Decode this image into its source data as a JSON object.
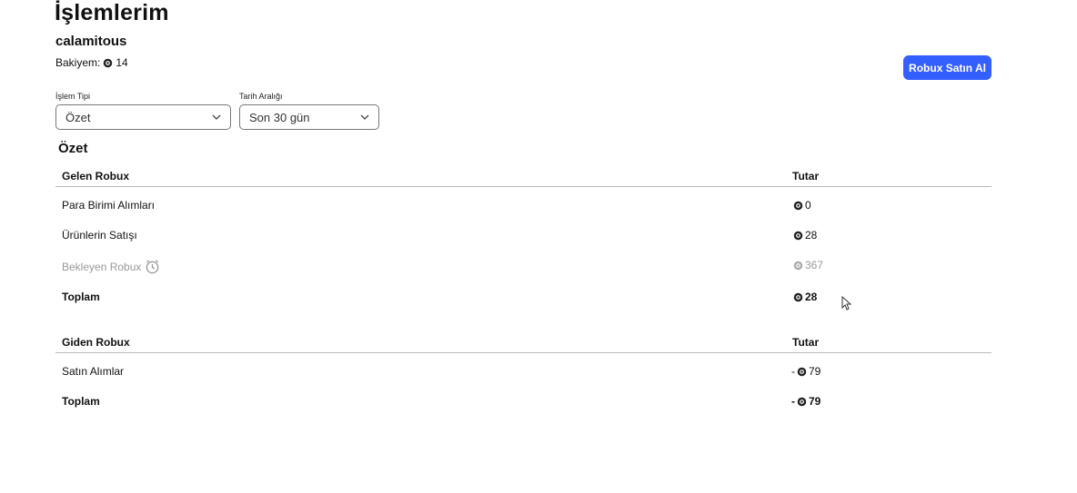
{
  "header": {
    "title": "İşlemlerim",
    "username": "calamitous",
    "balance_label": "Bakiyem:",
    "balance_value": "14",
    "buy_button": "Robux Satın Al"
  },
  "filters": {
    "type_label": "İşlem Tipi",
    "type_value": "Özet",
    "date_label": "Tarih Aralığı",
    "date_value": "Son 30 gün"
  },
  "summary": {
    "title": "Özet",
    "incoming": {
      "header": "Gelen Robux",
      "amount_header": "Tutar",
      "rows": [
        {
          "label": "Para Birimi Alımları",
          "amount": "0"
        },
        {
          "label": "Ürünlerin Satışı",
          "amount": "28"
        },
        {
          "label": "Bekleyen Robux",
          "amount": "367"
        },
        {
          "label": "Toplam",
          "amount": "28"
        }
      ]
    },
    "outgoing": {
      "header": "Giden Robux",
      "amount_header": "Tutar",
      "rows": [
        {
          "label": "Satın Alımlar",
          "prefix": "-",
          "amount": "79"
        },
        {
          "label": "Toplam",
          "prefix": "-",
          "amount": "79"
        }
      ]
    }
  },
  "icons": {
    "robux": "robux-icon",
    "pending": "clock-icon",
    "chevron": "chevron-down-icon"
  },
  "colors": {
    "accent": "#335fff",
    "muted_text": "#999999"
  }
}
